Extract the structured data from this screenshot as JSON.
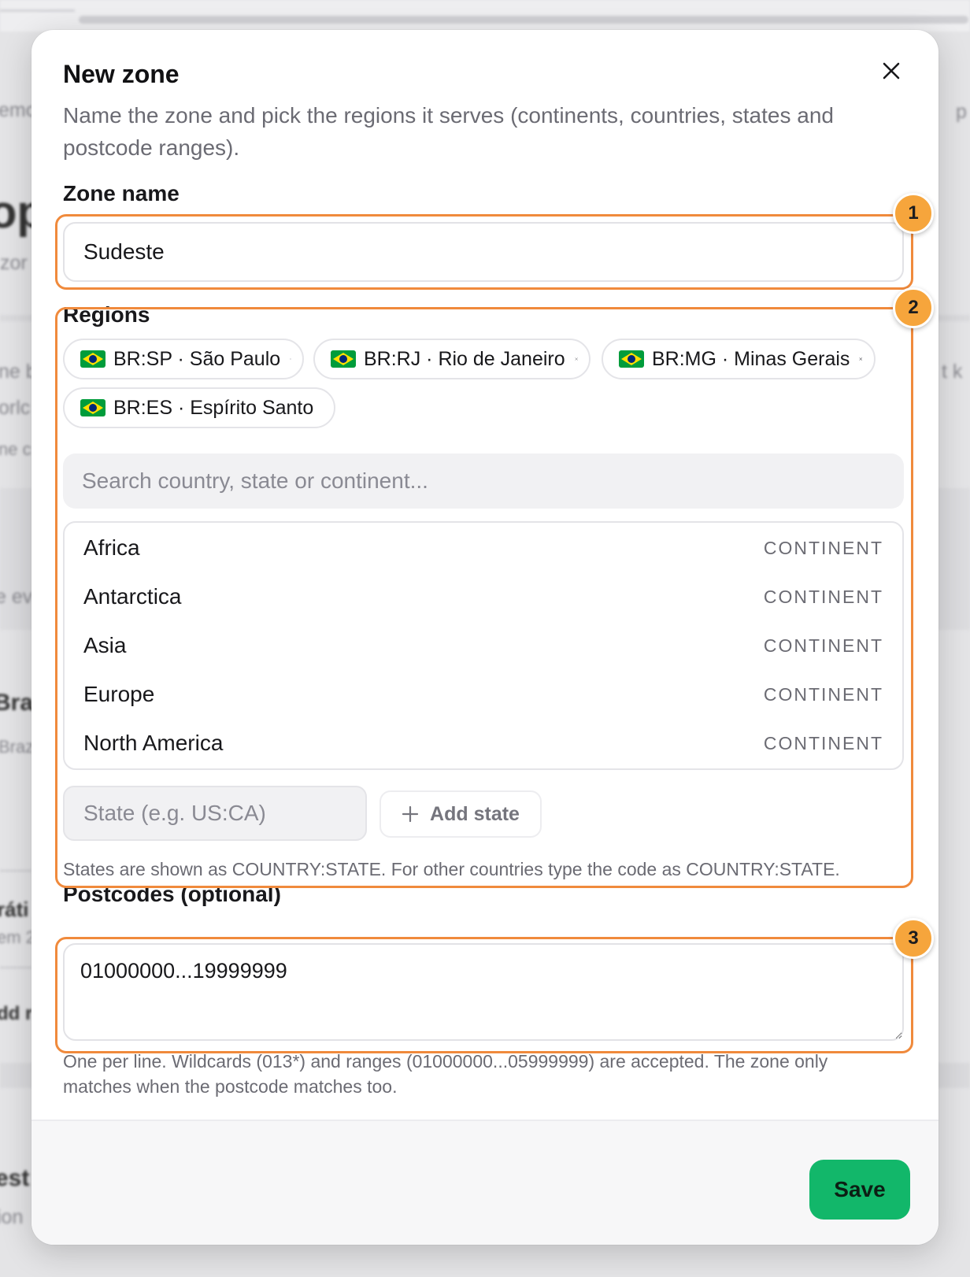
{
  "background": {
    "fragments": [
      "emo",
      "op",
      "zor",
      "ne b",
      "orlc",
      "ne c",
      "e ev",
      "Bras",
      "Braz",
      "ráti",
      "em 2",
      "dd r",
      "est",
      "ion",
      "p",
      "t k"
    ]
  },
  "modal": {
    "title": "New zone",
    "description": "Name the zone and pick the regions it serves (continents, countries, states and postcode ranges).",
    "close_icon": "close-icon",
    "zone_name": {
      "label": "Zone name",
      "value": "Sudeste"
    },
    "regions": {
      "label": "Regions",
      "selected": [
        {
          "flag": "brazil-flag-icon",
          "label": "BR:SP · São Paulo"
        },
        {
          "flag": "brazil-flag-icon",
          "label": "BR:RJ · Rio de Janeiro"
        },
        {
          "flag": "brazil-flag-icon",
          "label": "BR:MG · Minas Gerais"
        },
        {
          "flag": "brazil-flag-icon",
          "label": "BR:ES · Espírito Santo"
        }
      ],
      "search_placeholder": "Search country, state or continent...",
      "results": [
        {
          "name": "Africa",
          "type": "CONTINENT"
        },
        {
          "name": "Antarctica",
          "type": "CONTINENT"
        },
        {
          "name": "Asia",
          "type": "CONTINENT"
        },
        {
          "name": "Europe",
          "type": "CONTINENT"
        },
        {
          "name": "North America",
          "type": "CONTINENT"
        }
      ],
      "state_placeholder": "State (e.g. US:CA)",
      "add_state_label": "Add state",
      "hint": "States are shown as COUNTRY:STATE. For other countries type the code as COUNTRY:STATE."
    },
    "postcodes": {
      "label": "Postcodes (optional)",
      "value": "01000000...19999999",
      "hint": "One per line. Wildcards (013*) and ranges (01000000...05999999) are accepted. The zone only matches when the postcode matches too."
    },
    "save_label": "Save"
  },
  "annotations": {
    "badges": [
      "1",
      "2",
      "3"
    ],
    "color": "#f08a3c",
    "badge_color": "#f6a53c"
  },
  "colors": {
    "accent": "#12b76a",
    "muted_text": "#6b6b73",
    "flag_green": "#009c3b",
    "flag_yellow": "#ffdf00",
    "flag_blue": "#002776"
  }
}
